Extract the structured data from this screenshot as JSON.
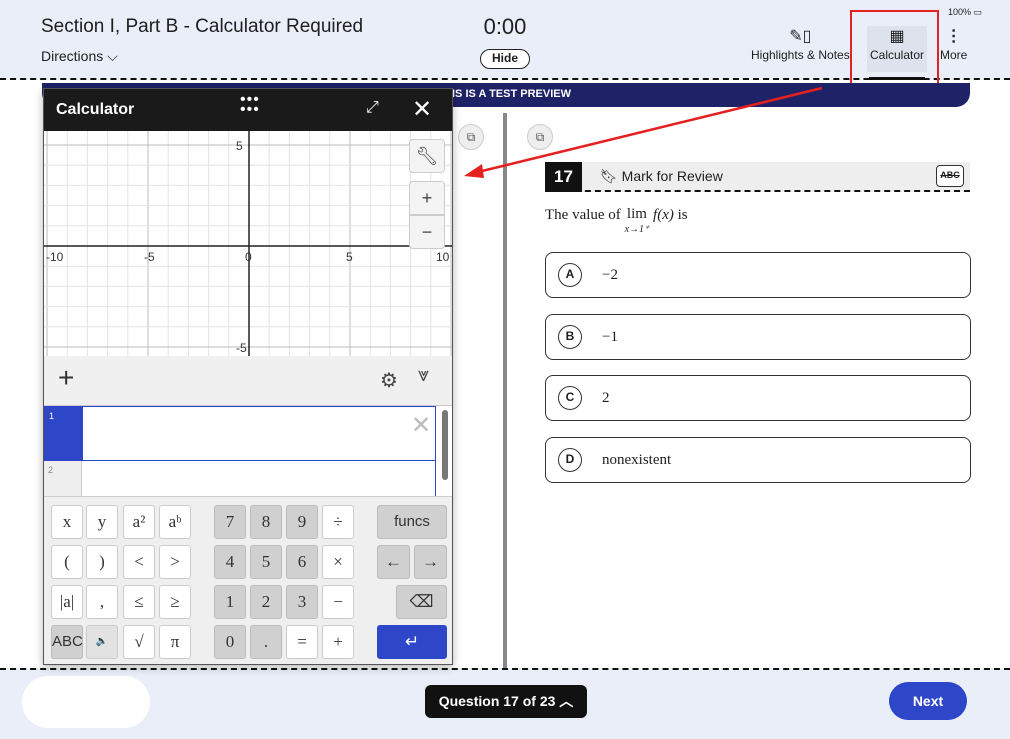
{
  "header": {
    "title": "Section I, Part B - Calculator Required",
    "directions": "Directions",
    "timer": "0:00",
    "hide": "Hide",
    "battery": "100%",
    "tools": [
      {
        "label": "Highlights & Notes",
        "icon": "pen-note-icon"
      },
      {
        "label": "Calculator",
        "icon": "calculator-icon"
      },
      {
        "label": "More",
        "icon": "more-vertical-icon"
      }
    ]
  },
  "banner": "IS IS A TEST PREVIEW",
  "question": {
    "number": "17",
    "mark": "Mark for Review",
    "abc": "ABC",
    "text_prefix": "The value of",
    "lim": "lim",
    "lim_sub": "x→1⁺",
    "func": "f(x)",
    "text_suffix": "is",
    "options": [
      {
        "letter": "A",
        "text": "−2"
      },
      {
        "letter": "B",
        "text": "−1"
      },
      {
        "letter": "C",
        "text": "2"
      },
      {
        "letter": "D",
        "text": "nonexistent"
      }
    ]
  },
  "footer": {
    "question_nav": "Question 17 of 23",
    "next": "Next"
  },
  "calculator": {
    "title": "Calculator",
    "graph": {
      "xlim": [
        -10,
        10
      ],
      "ylim": [
        -5,
        5
      ],
      "x_ticks": [
        "-10",
        "-5",
        "0",
        "5",
        "10"
      ],
      "y_ticks": [
        "5",
        "-5"
      ]
    },
    "expressions": [
      "1",
      "2"
    ],
    "keys": [
      [
        "x",
        "y",
        "a²",
        "aᵇ",
        "7",
        "8",
        "9",
        "÷",
        "funcs"
      ],
      [
        "(",
        ")",
        "<",
        ">",
        "4",
        "5",
        "6",
        "×",
        "←",
        "→"
      ],
      [
        "|a|",
        ",",
        "≤",
        "≥",
        "1",
        "2",
        "3",
        "−",
        "⌫"
      ],
      [
        "ABC",
        "🔈",
        "√",
        "π",
        "0",
        ".",
        "=",
        "+",
        "↵"
      ]
    ]
  },
  "colors": {
    "accent": "#2e46c8",
    "banner": "#1e2266",
    "highlight": "#e52020"
  }
}
